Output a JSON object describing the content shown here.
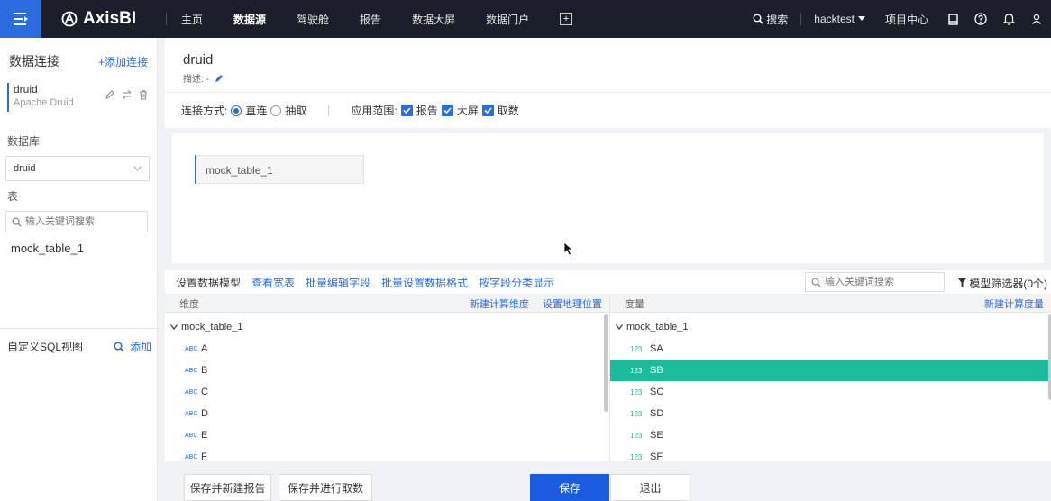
{
  "topbar": {
    "logo": "AxisBI",
    "nav": [
      "主页",
      "数据源",
      "驾驶舱",
      "报告",
      "数据大屏",
      "数据门户"
    ],
    "active_index": 1,
    "search_label": "搜索",
    "user": "hacktest",
    "project_center": "项目中心",
    "accent": "#2d6be0",
    "bg": "#1b1e2b"
  },
  "sidebar": {
    "title": "数据连接",
    "add_connection": "+添加连接",
    "connection": {
      "name": "druid",
      "type": "Apache Druid"
    },
    "db_label": "数据库",
    "db_value": "druid",
    "table_label": "表",
    "search_placeholder": "输入关键词搜索",
    "tables": [
      "mock_table_1"
    ],
    "sql_label": "自定义SQL视图",
    "sql_add": "添加"
  },
  "header": {
    "name": "druid",
    "desc": "描述: -",
    "conn_mode_label": "连接方式:",
    "mode_direct": "直连",
    "mode_extract": "抽取",
    "scope_label": "应用范围:",
    "scope": [
      "报告",
      "大屏",
      "取数"
    ]
  },
  "canvas": {
    "table_node": "mock_table_1"
  },
  "model_bar": {
    "first": "设置数据模型",
    "links": [
      "查看宽表",
      "批量编辑字段",
      "批量设置数据格式",
      "按字段分类显示"
    ],
    "search_placeholder": "输入关键词搜索",
    "filter": "模型筛选器(0个)"
  },
  "dimensions": {
    "title": "维度",
    "links": [
      "新建计算维度",
      "设置地理位置"
    ],
    "group": "mock_table_1",
    "tag": "ABC",
    "fields": [
      "A",
      "B",
      "C",
      "D",
      "E",
      "F"
    ]
  },
  "measures": {
    "title": "度量",
    "link": "新建计算度量",
    "group": "mock_table_1",
    "tag": "123",
    "fields": [
      "SA",
      "SB",
      "SC",
      "SD",
      "SE",
      "SF"
    ],
    "selected": "SB",
    "selected_color": "#1abc9c"
  },
  "footer": {
    "save_new_report": "保存并新建报告",
    "save_fetch": "保存并进行取数",
    "save": "保存",
    "exit": "退出"
  }
}
